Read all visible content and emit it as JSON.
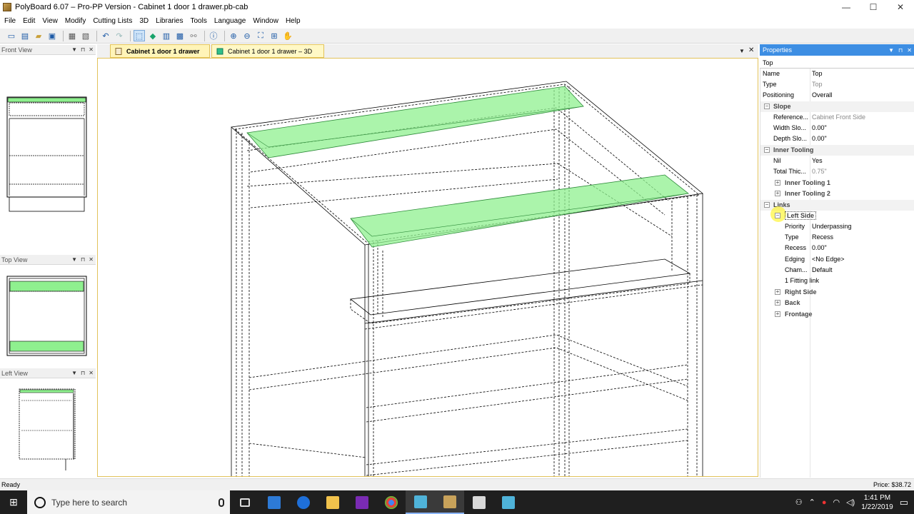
{
  "window": {
    "title": "PolyBoard 6.07 – Pro-PP Version - Cabinet 1 door 1 drawer.pb-cab",
    "minimize": "—",
    "maximize": "☐",
    "close": "✕"
  },
  "menu": [
    "File",
    "Edit",
    "View",
    "Modify",
    "Cutting Lists",
    "3D",
    "Libraries",
    "Tools",
    "Language",
    "Window",
    "Help"
  ],
  "toolbar": [
    "new-icon",
    "open-icon",
    "folder-icon",
    "save-icon",
    "print-icon",
    "print-preview-icon",
    "undo-icon",
    "redo-icon",
    "select-icon",
    "view-3d-icon",
    "render-icon",
    "cabinet-icon",
    "link-icon",
    "info-icon",
    "zoom-in-icon",
    "zoom-out-icon",
    "zoom-fit-icon",
    "zoom-window-icon",
    "pan-icon"
  ],
  "panels": {
    "front": "Front View",
    "top": "Top View",
    "left": "Left View"
  },
  "tabs": {
    "active": "Cabinet 1 door 1 drawer",
    "second": "Cabinet 1 door 1 drawer – 3D"
  },
  "properties": {
    "header": "Properties",
    "combo": "Top",
    "rows": {
      "name": {
        "label": "Name",
        "value": "Top"
      },
      "type": {
        "label": "Type",
        "value": "Top"
      },
      "positioning": {
        "label": "Positioning",
        "value": "Overall"
      },
      "slope": "Slope",
      "reference": {
        "label": "Reference...",
        "value": "Cabinet Front Side"
      },
      "width_slope": {
        "label": "Width Slo...",
        "value": "0.00\""
      },
      "depth_slope": {
        "label": "Depth Slo...",
        "value": "0.00\""
      },
      "inner_tooling": "Inner Tooling",
      "nil": {
        "label": "Nil",
        "value": "Yes"
      },
      "total_thick": {
        "label": "Total Thic...",
        "value": "0.75\""
      },
      "inner_tooling_1": "Inner Tooling 1",
      "inner_tooling_2": "Inner Tooling 2",
      "links": "Links",
      "left_side": "Left Side",
      "priority": {
        "label": "Priority",
        "value": "Underpassing"
      },
      "link_type": {
        "label": "Type",
        "value": "Recess"
      },
      "recess": {
        "label": "Recess",
        "value": "0.00\""
      },
      "edging": {
        "label": "Edging",
        "value": "<No Edge>"
      },
      "chamfer": {
        "label": "Cham...",
        "value": "Default"
      },
      "fitting": "1 Fitting link",
      "right_side": "Right Side",
      "back": "Back",
      "frontage": "Frontage"
    }
  },
  "status": {
    "left": "Ready",
    "price": "Price: $38.72"
  },
  "taskbar": {
    "search_placeholder": "Type here to search",
    "apps": [
      "task-view-icon",
      "store-icon",
      "teamviewer-icon",
      "explorer-icon",
      "onenote-icon",
      "chrome-icon",
      "polyboard-icon",
      "polyboard-doc-icon",
      "optimik-icon",
      "polyboard2-icon"
    ],
    "time": "1:41 PM",
    "date": "1/22/2019"
  },
  "colors": {
    "highlight": "#8ff08f",
    "tab": "#fff4b8",
    "accent": "#3d8ee3"
  }
}
